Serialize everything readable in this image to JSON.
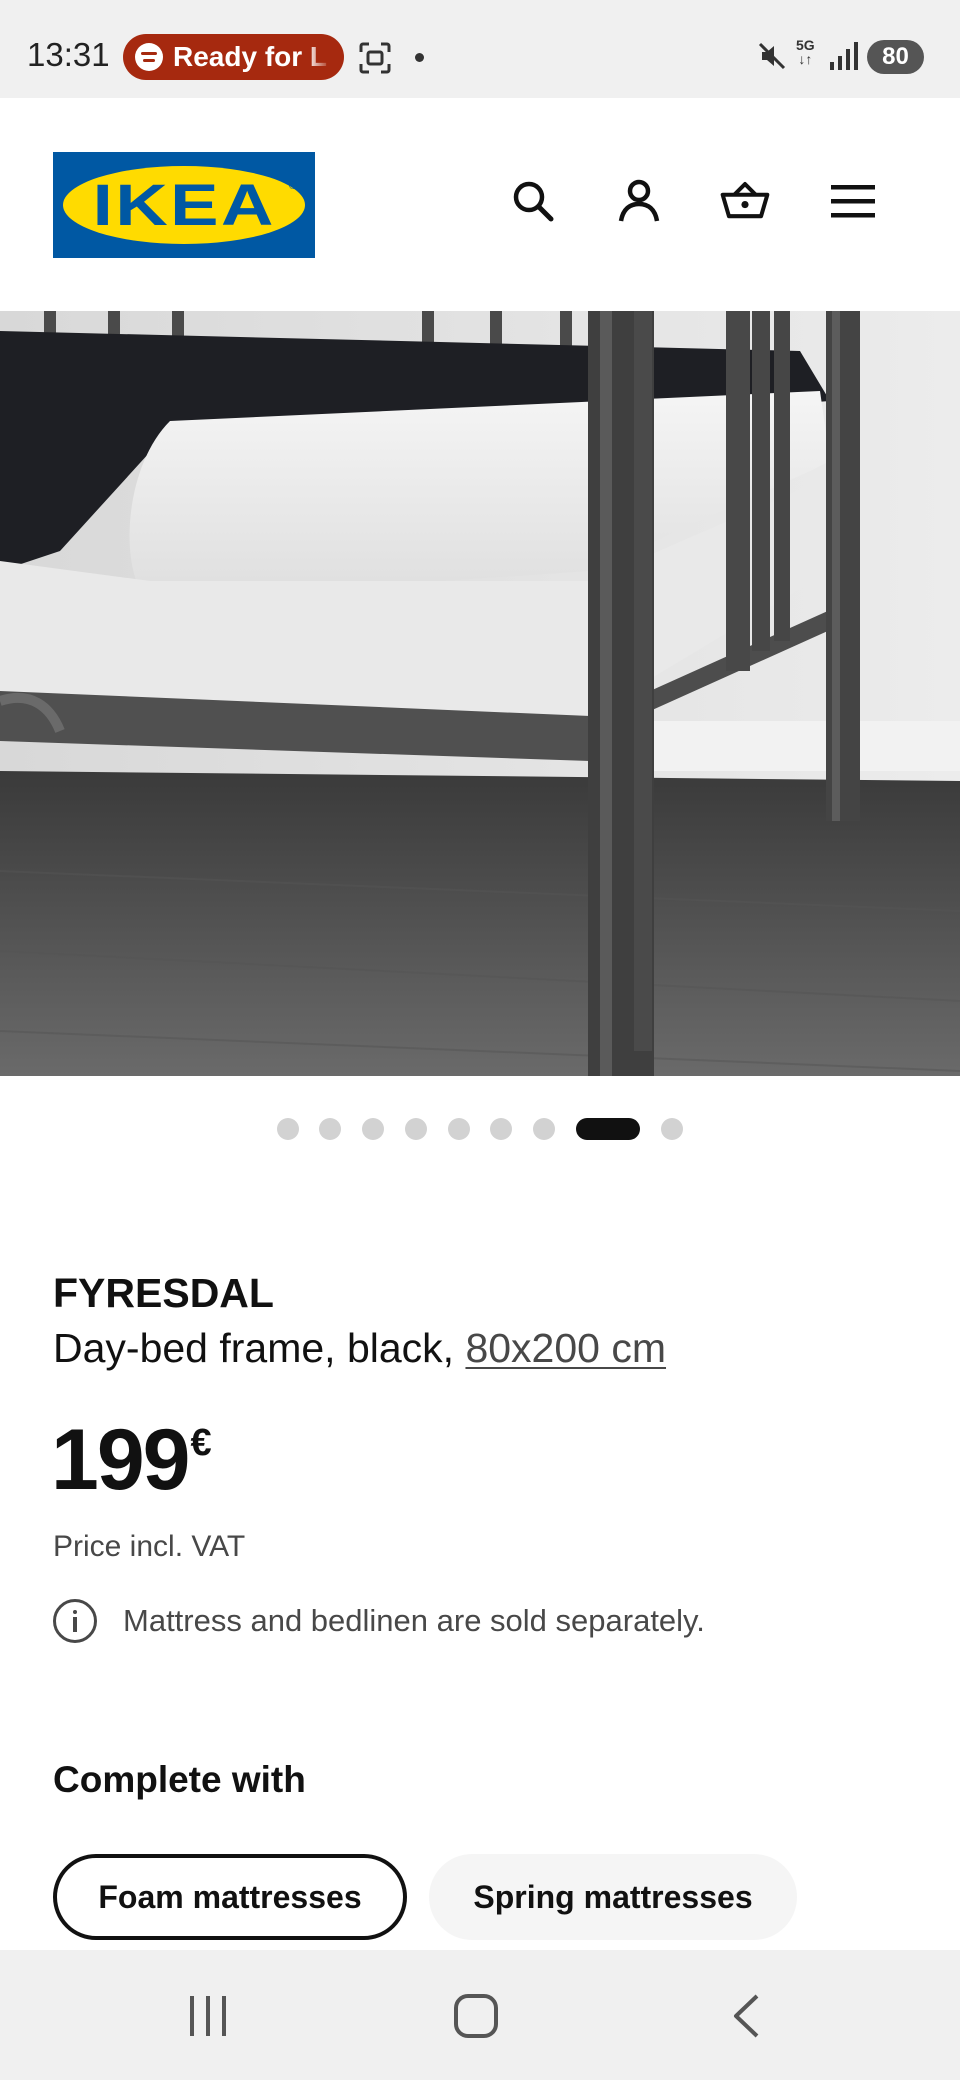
{
  "status_bar": {
    "time": "13:31",
    "now_playing_label": "Ready for L",
    "network": "5G",
    "battery": "80",
    "icons": [
      "spotify-icon",
      "screenshot-icon",
      "mute-icon",
      "signal-icon",
      "battery-icon"
    ]
  },
  "header": {
    "logo_text": "IKEA",
    "logo_colors": {
      "background": "#0058a3",
      "oval": "#ffdb00"
    },
    "icons": [
      "search-icon",
      "account-icon",
      "cart-icon",
      "menu-icon"
    ]
  },
  "gallery": {
    "image_count": 9,
    "active_index": 7
  },
  "product": {
    "name": "FYRESDAL",
    "description": "Day-bed frame, black, ",
    "size": "80x200 cm",
    "price": "199",
    "currency": "€",
    "price_note": "Price incl. VAT",
    "info": "Mattress and bedlinen are sold separately."
  },
  "complete_with": {
    "title": "Complete with",
    "chips": [
      {
        "label": "Foam mattresses",
        "selected": true
      },
      {
        "label": "Spring mattresses",
        "selected": false
      }
    ]
  },
  "nav_bar": {
    "icons": [
      "recent-apps-icon",
      "home-icon",
      "back-icon"
    ]
  }
}
